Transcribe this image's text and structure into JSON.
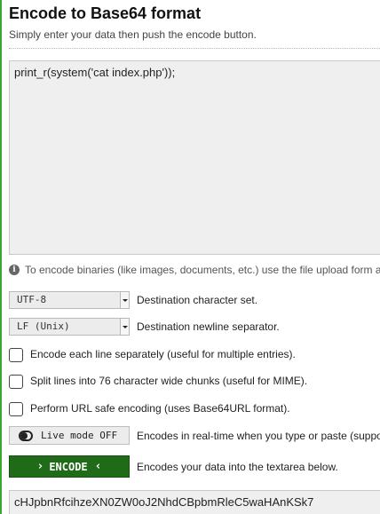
{
  "header": {
    "title": "Encode to Base64 format",
    "subtitle": "Simply enter your data then push the encode button."
  },
  "input": {
    "value": "print_r(system('cat index.php'));"
  },
  "info": {
    "icon": "info-icon",
    "text": "To encode binaries (like images, documents, etc.) use the file upload form a"
  },
  "options": {
    "charset": {
      "selected": "UTF-8",
      "label": "Destination character set."
    },
    "newline": {
      "selected": "LF (Unix)",
      "label": "Destination newline separator."
    },
    "checkboxes": [
      {
        "label": "Encode each line separately (useful for multiple entries).",
        "checked": false
      },
      {
        "label": "Split lines into 76 character wide chunks (useful for MIME).",
        "checked": false
      },
      {
        "label": "Perform URL safe encoding (uses Base64URL format).",
        "checked": false
      }
    ],
    "live_mode": {
      "button_label": "Live mode OFF",
      "description": "Encodes in real-time when you type or paste (suppo"
    }
  },
  "encode": {
    "button_label": "ENCODE",
    "description": "Encodes your data into the textarea below.",
    "button_color": "#1f6b18"
  },
  "output": {
    "value": "cHJpbnRfcihzeXN0ZW0oJ2NhdCBpbmRleC5waHAnKSk7"
  },
  "colors": {
    "accent_bar": "#3aa52f",
    "field_bg": "#efefef"
  }
}
